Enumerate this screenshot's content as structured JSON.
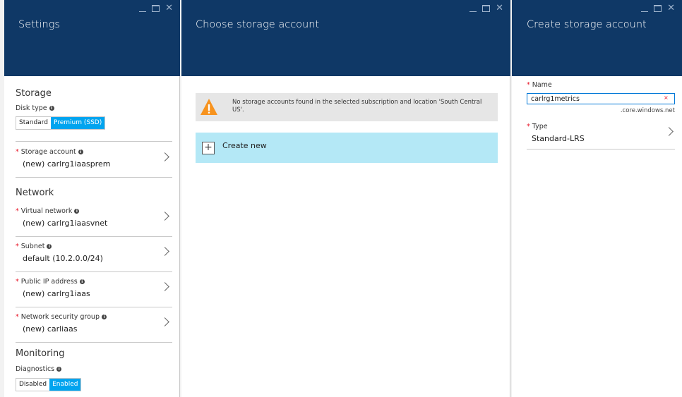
{
  "blade1": {
    "title": "Settings",
    "storage_heading": "Storage",
    "disk_type_label": "Disk type",
    "disk_type_options": [
      "Standard",
      "Premium (SSD)"
    ],
    "disk_type_selected": "Premium (SSD)",
    "storage_account": {
      "label": "Storage account",
      "value": "(new) carlrg1iaasprem"
    },
    "network_heading": "Network",
    "virtual_network": {
      "label": "Virtual network",
      "value": "(new) carlrg1iaasvnet"
    },
    "subnet": {
      "label": "Subnet",
      "value": "default (10.2.0.0/24)"
    },
    "public_ip": {
      "label": "Public IP address",
      "value": "(new) carlrg1iaas"
    },
    "nsg": {
      "label": "Network security group",
      "value": "(new) carliaas"
    },
    "monitoring_heading": "Monitoring",
    "diagnostics_label": "Diagnostics",
    "diagnostics_options": [
      "Disabled",
      "Enabled"
    ],
    "diagnostics_selected": "Enabled"
  },
  "blade2": {
    "title": "Choose storage account",
    "warning_text": "No storage accounts found in the selected subscription and location 'South Central US'.",
    "create_new_label": "Create new"
  },
  "blade3": {
    "title": "Create storage account",
    "name_label": "Name",
    "name_value": "carlrg1metrics",
    "name_suffix": ".core.windows.net",
    "clear_glyph": "×",
    "type_label": "Type",
    "type_value": "Standard-LRS"
  },
  "icons": [
    "window-minimize-icon",
    "window-maximize-icon",
    "window-close-icon",
    "info-icon",
    "chevron-right-icon",
    "warning-icon",
    "plus-icon"
  ],
  "colors": {
    "header": "#0f3866",
    "toggle_on": "#00a4ef",
    "create_bg": "#b4e8f6",
    "required": "#e81123",
    "input_border": "#0078d7"
  }
}
